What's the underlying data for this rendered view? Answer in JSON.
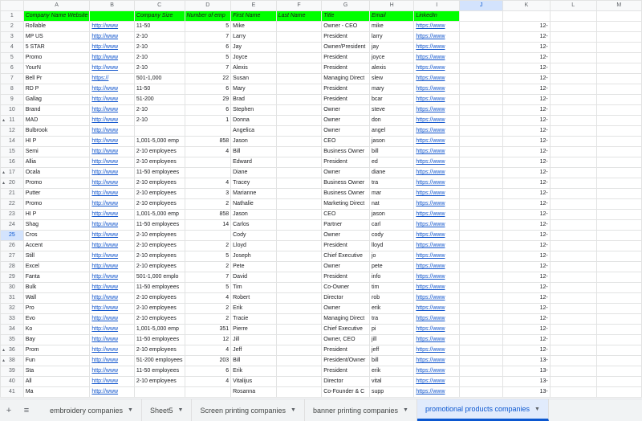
{
  "columns": [
    "A",
    "B",
    "C",
    "D",
    "E",
    "F",
    "G",
    "H",
    "I",
    "J",
    "K",
    "L",
    "M"
  ],
  "active_column": "J",
  "header_row": {
    "number": "1",
    "cells": [
      "Company Name Website",
      "",
      "Company Size",
      "Number of emp",
      "First Name",
      "Last Name",
      "Title",
      "Email",
      "LinkedIn"
    ]
  },
  "rows": [
    {
      "n": "2",
      "a": "Rollable",
      "b": "http://www",
      "c": "11-50",
      "d": "5",
      "e": "Mike",
      "f": "",
      "g": "Owner - CEO",
      "h": "mike",
      "i": "https://www",
      "k": "12-"
    },
    {
      "n": "3",
      "a": "MP US",
      "b": "http://www",
      "c": "2-10",
      "d": "7",
      "e": "Larry",
      "f": "",
      "g": "President",
      "h": "larry",
      "i": "https://www",
      "k": "12-"
    },
    {
      "n": "4",
      "a": "5 STAR",
      "b": "http://www",
      "c": "2-10",
      "d": "6",
      "e": "Jay",
      "f": "",
      "g": "Owner/President",
      "h": "jay",
      "i": "https://www",
      "k": "12-"
    },
    {
      "n": "5",
      "a": "Promo",
      "b": "http://www",
      "c": "2-10",
      "d": "5",
      "e": "Joyce",
      "f": "",
      "g": "President",
      "h": "joyce",
      "i": "https://www",
      "k": "12-"
    },
    {
      "n": "6",
      "a": "YourN",
      "b": "http://www",
      "c": "2-10",
      "d": "7",
      "e": "Alexis",
      "f": "",
      "g": "President",
      "h": "alexis",
      "i": "https://www",
      "k": "12-"
    },
    {
      "n": "7",
      "a": "Bell Pr",
      "b": "https://",
      "c": "501-1,000",
      "d": "22",
      "e": "Susan",
      "f": "",
      "g": "Managing Direct",
      "h": "slew",
      "i": "https://www",
      "k": "12-"
    },
    {
      "n": "8",
      "a": "RD P",
      "b": "http://www",
      "c": "11-50",
      "d": "6",
      "e": "Mary",
      "f": "",
      "g": "President",
      "h": "mary",
      "i": "https://www",
      "k": "12-"
    },
    {
      "n": "9",
      "a": "Gallag",
      "b": "http://www",
      "c": "51-200",
      "d": "29",
      "e": "Brad",
      "f": "",
      "g": "President",
      "h": "bcar",
      "i": "https://www",
      "k": "12-"
    },
    {
      "n": "10",
      "a": "Brand",
      "b": "http://www",
      "c": "2-10",
      "d": "6",
      "e": "Stephen",
      "f": "",
      "g": "Owner",
      "h": "steve",
      "i": "https://www",
      "k": "12-"
    },
    {
      "n": "11",
      "a": "MAD",
      "b": "http://www",
      "c": "2-10",
      "d": "1",
      "e": "Donna",
      "f": "",
      "g": "Owner",
      "h": "don",
      "i": "https://www",
      "k": "12-"
    },
    {
      "n": "12",
      "a": "Bulbrook",
      "b": "http://www",
      "c": "",
      "d": "",
      "e": "Angelica",
      "f": "",
      "g": "Owner",
      "h": "angel",
      "i": "https://www",
      "k": "12-"
    },
    {
      "n": "14",
      "a": "HI P",
      "b": "http://www",
      "c": "1,001-5,000 emp",
      "d": "858",
      "e": "Jason",
      "f": "",
      "g": "CEO",
      "h": "jason",
      "i": "https://www",
      "k": "12-"
    },
    {
      "n": "15",
      "a": "Semi",
      "b": "http://www",
      "c": "2-10 employees",
      "d": "4",
      "e": "Bill",
      "f": "",
      "g": "Business Owner",
      "h": "bill",
      "i": "https://www",
      "k": "12-"
    },
    {
      "n": "16",
      "a": "Allia",
      "b": "http://www",
      "c": "2-10 employees",
      "d": "",
      "e": "Edward",
      "f": "",
      "g": "President",
      "h": "ed",
      "i": "https://www",
      "k": "12-"
    },
    {
      "n": "17",
      "a": "Ocala",
      "b": "http://www",
      "c": "11-50 employees",
      "d": "",
      "e": "Diane",
      "f": "",
      "g": "Owner",
      "h": "diane",
      "i": "https://www",
      "k": "12-"
    },
    {
      "n": "20",
      "a": "Promo",
      "b": "http://www",
      "c": "2-10 employees",
      "d": "4",
      "e": "Tracey",
      "f": "",
      "g": "Business Owner",
      "h": "tra",
      "i": "https://www",
      "k": "12-"
    },
    {
      "n": "21",
      "a": "Putter",
      "b": "http://www",
      "c": "2-10 employees",
      "d": "3",
      "e": "Marianne",
      "f": "",
      "g": "Business Owner",
      "h": "mar",
      "i": "https://www",
      "k": "12-"
    },
    {
      "n": "22",
      "a": "Promo",
      "b": "http://www",
      "c": "2-10 employees",
      "d": "2",
      "e": "Nathalie",
      "f": "",
      "g": "Marketing Direct",
      "h": "nat",
      "i": "https://www",
      "k": "12-"
    },
    {
      "n": "23",
      "a": "HI P",
      "b": "http://www",
      "c": "1,001-5,000 emp",
      "d": "858",
      "e": "Jason",
      "f": "",
      "g": "CEO",
      "h": "jason",
      "i": "https://www",
      "k": "12-"
    },
    {
      "n": "24",
      "a": "Shag",
      "b": "http://www",
      "c": "11-50 employees",
      "d": "14",
      "e": "Carlos",
      "f": "",
      "g": "Partner",
      "h": "carl",
      "i": "https://www",
      "k": "12-"
    },
    {
      "n": "25",
      "a": "Cros",
      "b": "http://www",
      "c": "2-10 employees",
      "d": "",
      "e": "Cody",
      "f": "",
      "g": "Owner",
      "h": "cody",
      "i": "https://www",
      "k": "12-"
    },
    {
      "n": "26",
      "a": "Accent",
      "b": "http://www",
      "c": "2-10 employees",
      "d": "2",
      "e": "Lloyd",
      "f": "",
      "g": "President",
      "h": "lloyd",
      "i": "https://www",
      "k": "12-"
    },
    {
      "n": "27",
      "a": "Still",
      "b": "http://www",
      "c": "2-10 employees",
      "d": "5",
      "e": "Joseph",
      "f": "",
      "g": "Chief Executive",
      "h": "jo",
      "i": "https://www",
      "k": "12-"
    },
    {
      "n": "28",
      "a": "Excel",
      "b": "http://www",
      "c": "2-10 employees",
      "d": "2",
      "e": "Pete",
      "f": "",
      "g": "Owner",
      "h": "pete",
      "i": "https://www",
      "k": "12-"
    },
    {
      "n": "29",
      "a": "Fanta",
      "b": "http://www",
      "c": "501-1,000 emplo",
      "d": "7",
      "e": "David",
      "f": "",
      "g": "President",
      "h": "info",
      "i": "https://www",
      "k": "12-"
    },
    {
      "n": "30",
      "a": "Bulk",
      "b": "http://www",
      "c": "11-50 employees",
      "d": "5",
      "e": "Tim",
      "f": "",
      "g": "Co-Owner",
      "h": "tim",
      "i": "https://www",
      "k": "12-"
    },
    {
      "n": "31",
      "a": "Wall",
      "b": "http://www",
      "c": "2-10 employees",
      "d": "4",
      "e": "Robert",
      "f": "",
      "g": "Director",
      "h": "rob",
      "i": "https://www",
      "k": "12-"
    },
    {
      "n": "32",
      "a": "Pro",
      "b": "http://www",
      "c": "2-10 employees",
      "d": "2",
      "e": "Erik",
      "f": "",
      "g": "Owner",
      "h": "erik",
      "i": "https://www",
      "k": "12-"
    },
    {
      "n": "33",
      "a": "Evo",
      "b": "http://www",
      "c": "2-10 employees",
      "d": "2",
      "e": "Tracie",
      "f": "",
      "g": "Managing Direct",
      "h": "tra",
      "i": "https://www",
      "k": "12-"
    },
    {
      "n": "34",
      "a": "Ko",
      "b": "http://www",
      "c": "1,001-5,000 emp",
      "d": "351",
      "e": "Pierre",
      "f": "",
      "g": "Chief Executive",
      "h": "pi",
      "i": "https://www",
      "k": "12-"
    },
    {
      "n": "35",
      "a": "Bay",
      "b": "http://www",
      "c": "11-50 employees",
      "d": "12",
      "e": "Jill",
      "f": "",
      "g": "Owner, CEO",
      "h": "jill",
      "i": "https://www",
      "k": "12-"
    },
    {
      "n": "36",
      "a": "Prom",
      "b": "http://www",
      "c": "2-10 employees",
      "d": "4",
      "e": "Jeff",
      "f": "",
      "g": "President",
      "h": "jeff",
      "i": "https://www",
      "k": "12-"
    },
    {
      "n": "38",
      "a": "Fun",
      "b": "http://www",
      "c": "51-200 employees",
      "d": "203",
      "e": "Bill",
      "f": "",
      "g": "President/Owner",
      "h": "bill",
      "i": "https://www",
      "k": "13-"
    },
    {
      "n": "39",
      "a": "Sta",
      "b": "http://www",
      "c": "11-50 employees",
      "d": "6",
      "e": "Erik",
      "f": "",
      "g": "President",
      "h": "erik",
      "i": "https://www",
      "k": "13-"
    },
    {
      "n": "40",
      "a": "All",
      "b": "http://www",
      "c": "2-10 employees",
      "d": "4",
      "e": "Vitalijus",
      "f": "",
      "g": "Director",
      "h": "vital",
      "i": "https://www",
      "k": "13-"
    },
    {
      "n": "41",
      "a": "Ma",
      "b": "http://www",
      "c": "",
      "d": "",
      "e": "Rosanna",
      "f": "",
      "g": "Co-Founder & C",
      "h": "supp",
      "i": "https://www",
      "k": "13-"
    }
  ],
  "active_row": "25",
  "grouped_rows": [
    "11",
    "13",
    "17",
    "20",
    "36",
    "38"
  ],
  "tabs": [
    {
      "label": "embroidery companies",
      "active": false
    },
    {
      "label": "Sheet5",
      "active": false
    },
    {
      "label": "Screen printing companies",
      "active": false
    },
    {
      "label": "banner printing companies",
      "active": false
    },
    {
      "label": "promotional products companies",
      "active": true
    }
  ],
  "icons": {
    "add_sheet": "plus-icon",
    "all_sheets": "menu-icon",
    "tab_menu": "caret-down-icon"
  },
  "colors": {
    "header_fill": "#00ff00",
    "link": "#1155cc",
    "selection": "#1a73e8",
    "active_tab": "#0b57d0"
  }
}
